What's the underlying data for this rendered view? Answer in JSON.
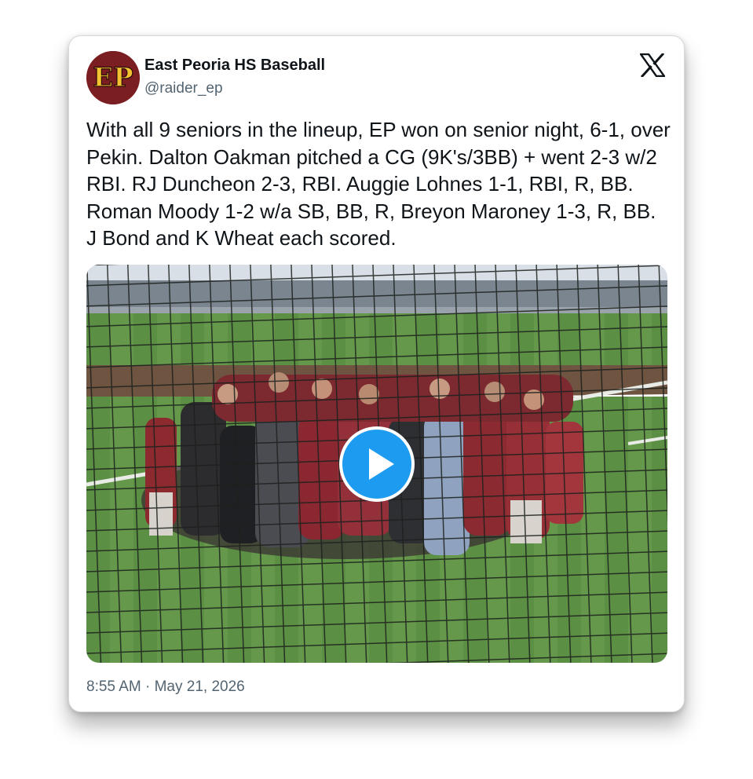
{
  "account": {
    "avatar_text": "EP",
    "display_name": "East Peoria HS Baseball",
    "handle": "@raider_ep"
  },
  "brand": {
    "avatar_bg": "#7a1e22",
    "avatar_letter_color": "#f2c230",
    "play_button_color": "#1d9bf0"
  },
  "icons": {
    "platform": "x-logo-icon",
    "play": "play-icon"
  },
  "tweet": {
    "text": "With all 9 seniors in the lineup, EP won on senior night, 6-1, over Pekin. Dalton Oakman pitched a CG (9K's/3BB) + went 2-3 w/2 RBI. RJ Duncheon 2-3, RBI. Auggie Lohnes 1-1, RBI, R, BB. Roman Moody 1-2 w/a SB, BB, R, Breyon Maroney 1-3, R, BB. J Bond and K Wheat each scored.",
    "timestamp": "8:55 AM · May 21, 2026"
  }
}
